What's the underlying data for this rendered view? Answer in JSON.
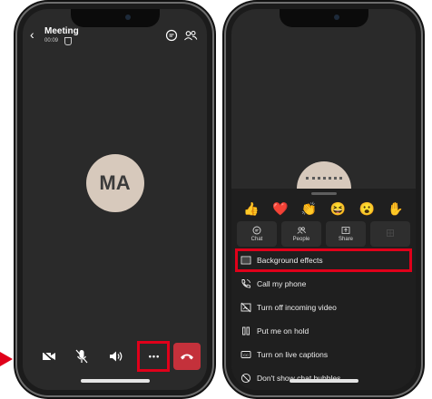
{
  "left_phone": {
    "meeting_title": "Meeting",
    "meeting_time": "00:09",
    "avatar_initials": "MA",
    "controls": {
      "camera": "video-off-icon",
      "mic": "mic-off-icon",
      "speaker": "speaker-icon",
      "more": "•••",
      "end": "hang-up-icon"
    },
    "colors": {
      "end_call": "#c4313b",
      "highlight": "#e0001a"
    }
  },
  "right_phone": {
    "reactions": [
      "👍",
      "❤️",
      "👏",
      "😆",
      "😮",
      "✋"
    ],
    "quick_actions": [
      {
        "label": "Chat",
        "icon": "chat-icon"
      },
      {
        "label": "People",
        "icon": "people-icon"
      },
      {
        "label": "Share",
        "icon": "share-icon"
      },
      {
        "label": "",
        "icon": "whiteboard-icon"
      }
    ],
    "menu": [
      {
        "label": "Background effects",
        "icon": "background-icon"
      },
      {
        "label": "Call my phone",
        "icon": "phone-icon"
      },
      {
        "label": "Turn off incoming video",
        "icon": "video-off-icon"
      },
      {
        "label": "Put me on hold",
        "icon": "pause-icon"
      },
      {
        "label": "Turn on live captions",
        "icon": "cc-icon"
      },
      {
        "label": "Don't show chat bubbles",
        "icon": "no-chat-icon"
      }
    ]
  }
}
